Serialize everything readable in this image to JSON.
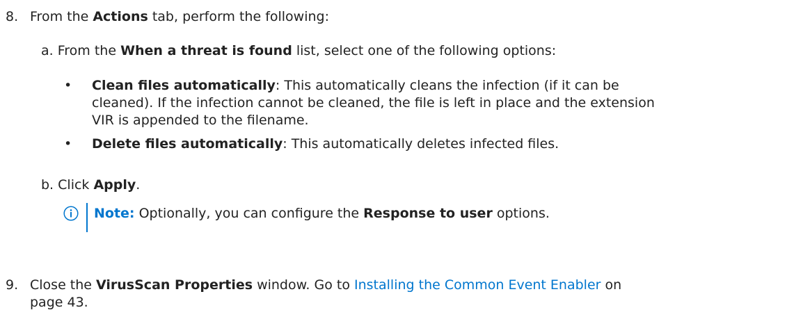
{
  "step8": {
    "number": "8.",
    "pre": "From the ",
    "tab": "Actions",
    "post": " tab, perform the following:"
  },
  "substep_a": {
    "marker": "a.",
    "pre": " From the ",
    "list": "When a threat is found",
    "post": " list, select one of the following options:"
  },
  "bullets": [
    {
      "dot": "•",
      "term": "Clean files automatically",
      "desc_line1": ": This automatically cleans the infection (if it can be",
      "desc_line2": "cleaned). If the infection cannot be cleaned, the file is left in place and the extension",
      "desc_line3": "VIR is appended to the filename."
    },
    {
      "dot": "•",
      "term": "Delete files automatically",
      "desc_line1": ": This automatically deletes infected files."
    }
  ],
  "substep_b": {
    "marker": "b.",
    "pre": " Click ",
    "action": "Apply",
    "post": "."
  },
  "note": {
    "icon": "info-icon",
    "label": "Note:",
    "pre": " Optionally, you can configure the ",
    "emph": "Response to user",
    "post": " options."
  },
  "step9": {
    "number": "9.",
    "pre": "Close the ",
    "window": "VirusScan Properties",
    "mid": " window. Go to ",
    "link": "Installing the Common Event Enabler",
    "post_line1": " on",
    "line2": "page 43."
  },
  "colors": {
    "text": "#222222",
    "link": "#0076ce",
    "note_accent": "#0076ce"
  }
}
